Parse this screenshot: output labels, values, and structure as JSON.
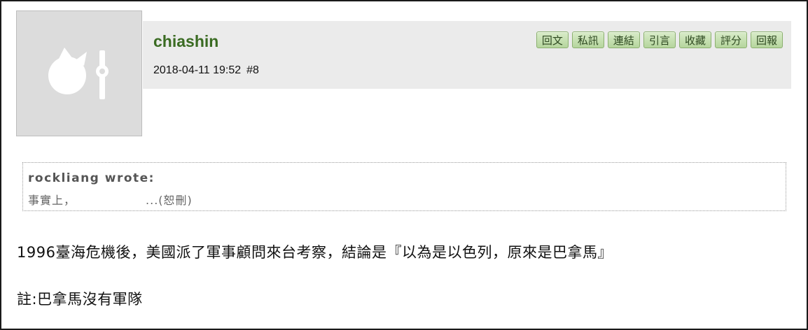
{
  "post": {
    "username": "chiashin",
    "datetime": "2018-04-11 19:52",
    "post_number": "#8",
    "actions": [
      "回文",
      "私訊",
      "連結",
      "引言",
      "收藏",
      "評分",
      "回報"
    ]
  },
  "quote": {
    "author": "rockliang wrote:",
    "text_start": "事實上，",
    "text_end": "...(恕刪)"
  },
  "body": {
    "line1": "1996臺海危機後，美國派了軍事顧問來台考察，結論是『以為是以色列，原來是巴拿馬』",
    "line2": "註:巴拿馬沒有軍隊"
  },
  "colors": {
    "username": "#3a6b22",
    "header_bg": "#ebebeb",
    "avatar_bg": "#dcdcdc",
    "button_bg": "#c6e2b0"
  },
  "icons": {
    "avatar": "default-avatar-icon"
  }
}
